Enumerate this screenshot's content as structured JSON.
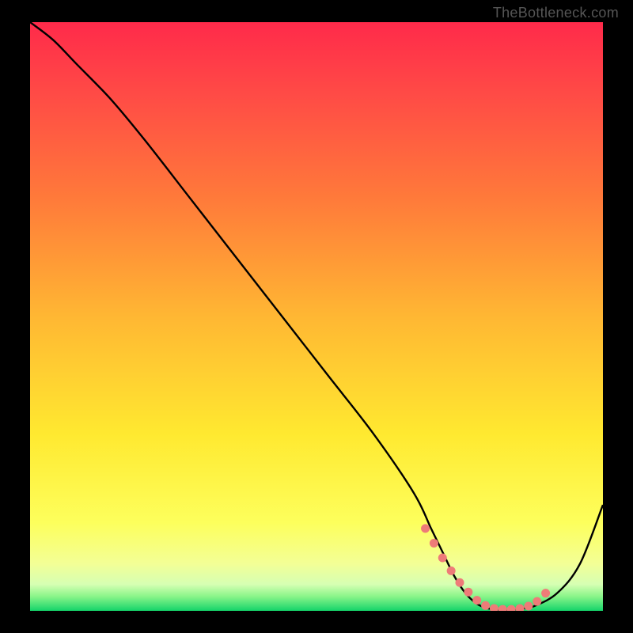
{
  "watermark": "TheBottleneck.com",
  "chart_data": {
    "type": "line",
    "title": "",
    "xlabel": "",
    "ylabel": "",
    "xlim": [
      0,
      100
    ],
    "ylim": [
      0,
      100
    ],
    "gradient_stops": [
      {
        "offset": 0.0,
        "color": "#ff2a4a"
      },
      {
        "offset": 0.12,
        "color": "#ff4a46"
      },
      {
        "offset": 0.3,
        "color": "#ff7a3a"
      },
      {
        "offset": 0.5,
        "color": "#ffb733"
      },
      {
        "offset": 0.7,
        "color": "#ffe930"
      },
      {
        "offset": 0.85,
        "color": "#fdff5c"
      },
      {
        "offset": 0.92,
        "color": "#f3ff96"
      },
      {
        "offset": 0.955,
        "color": "#d6ffb3"
      },
      {
        "offset": 0.975,
        "color": "#8cf58a"
      },
      {
        "offset": 1.0,
        "color": "#14d46a"
      }
    ],
    "series": [
      {
        "name": "curve",
        "x": [
          0,
          4,
          8,
          14,
          20,
          28,
          36,
          44,
          52,
          60,
          67,
          70,
          72,
          74,
          76,
          78,
          80,
          82,
          84,
          86,
          88,
          92,
          96,
          100
        ],
        "y": [
          100,
          97,
          93,
          87,
          80,
          70,
          60,
          50,
          40,
          30,
          20,
          14,
          10,
          6,
          3,
          1.2,
          0.4,
          0.2,
          0.2,
          0.4,
          0.8,
          3,
          8,
          18
        ]
      }
    ],
    "marker_band": {
      "color": "#ee7b78",
      "x": [
        69,
        70.5,
        72,
        73.5,
        75,
        76.5,
        78,
        79.5,
        81,
        82.5,
        84,
        85.5,
        87,
        88.5,
        90
      ],
      "y": [
        14,
        11.5,
        9,
        6.8,
        4.8,
        3.2,
        1.8,
        0.9,
        0.4,
        0.25,
        0.25,
        0.4,
        0.8,
        1.6,
        3.0
      ]
    }
  }
}
